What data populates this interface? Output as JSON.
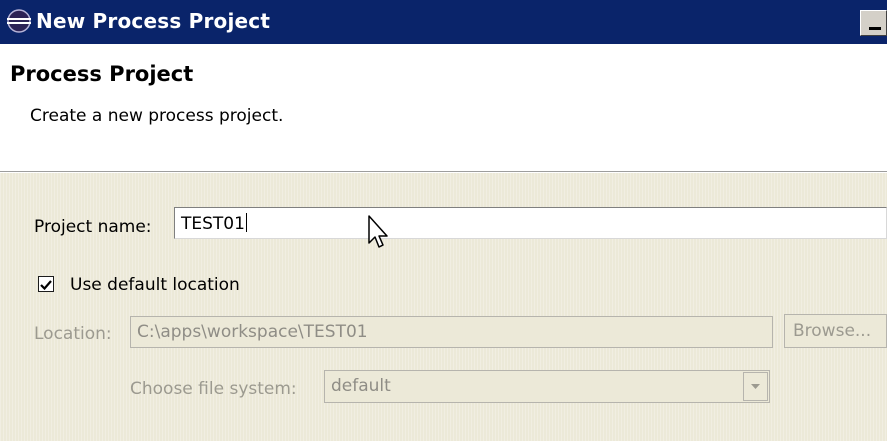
{
  "window": {
    "title": "New Process Project",
    "icon": "eclipse-icon"
  },
  "header": {
    "title": "Process Project",
    "description": "Create a new process project."
  },
  "form": {
    "project_name_label": "Project name:",
    "project_name_value": "TEST01",
    "use_default_location_label": "Use default location",
    "use_default_location_checked": true,
    "location_label": "Location:",
    "location_value": "C:\\apps\\workspace\\TEST01",
    "browse_label": "Browse...",
    "file_system_label": "Choose file system:",
    "file_system_value": "default"
  },
  "colors": {
    "titlebar": "#0a246a",
    "dialog_bg": "#ece9d8",
    "disabled_text": "#9c9a90"
  }
}
